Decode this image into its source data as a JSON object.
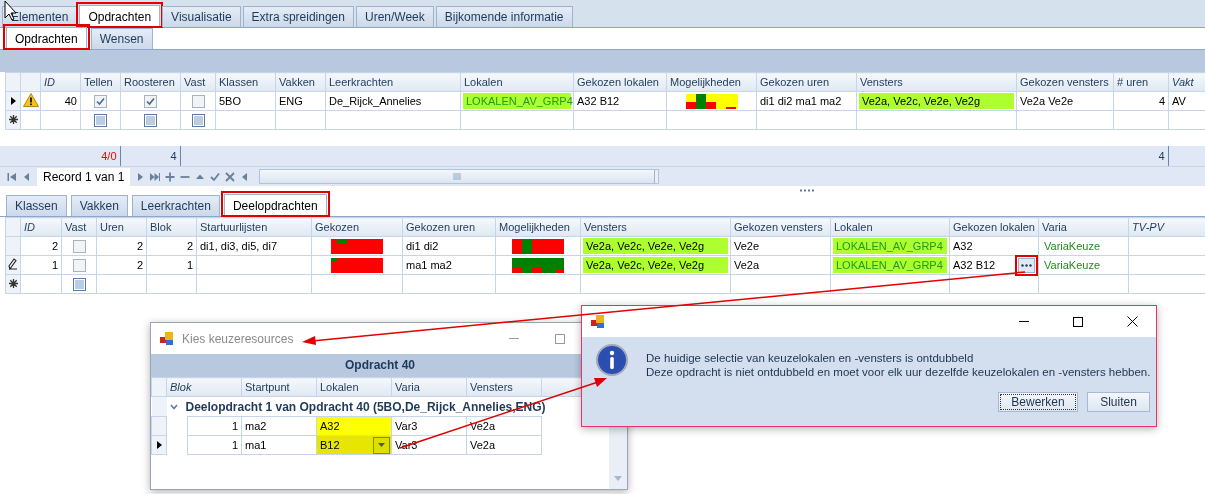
{
  "top_tabs": [
    {
      "label": "Elementen",
      "selected": false
    },
    {
      "label": "Opdrachten",
      "selected": true
    },
    {
      "label": "Visualisatie",
      "selected": false
    },
    {
      "label": "Extra spreidingen",
      "selected": false
    },
    {
      "label": "Uren/Week",
      "selected": false
    },
    {
      "label": "Bijkomende informatie",
      "selected": false
    }
  ],
  "sub_tabs": [
    {
      "label": "Opdrachten",
      "selected": true
    },
    {
      "label": "Wensen",
      "selected": false
    }
  ],
  "assignments_grid": {
    "columns": [
      {
        "label": "ID",
        "italic": true
      },
      {
        "label": "Tellen",
        "italic": false
      },
      {
        "label": "Roosteren",
        "italic": false
      },
      {
        "label": "Vast",
        "italic": false
      },
      {
        "label": "Klassen",
        "italic": false
      },
      {
        "label": "Vakken",
        "italic": false
      },
      {
        "label": "Leerkrachten",
        "italic": false
      },
      {
        "label": "Lokalen",
        "italic": false
      },
      {
        "label": "Gekozen lokalen",
        "italic": false
      },
      {
        "label": "Mogelijkheden",
        "italic": false
      },
      {
        "label": "Gekozen uren",
        "italic": false
      },
      {
        "label": "Vensters",
        "italic": false
      },
      {
        "label": "Gekozen vensters",
        "italic": false
      },
      {
        "label": "# uren",
        "italic": false
      },
      {
        "label": "Vakt",
        "italic": true
      }
    ],
    "rows": [
      {
        "kind": "current",
        "warning": true,
        "cells": [
          {
            "kind": "num",
            "text": "40"
          },
          {
            "kind": "check",
            "checked": true
          },
          {
            "kind": "check",
            "checked": true
          },
          {
            "kind": "check",
            "checked": false
          },
          {
            "kind": "text",
            "text": "5BO"
          },
          {
            "kind": "text",
            "text": "ENG"
          },
          {
            "kind": "text",
            "text": "De_Rijck_Annelies"
          },
          {
            "kind": "resource-group",
            "text": "LOKALEN_AV_GRP4"
          },
          {
            "kind": "text",
            "text": "A32 B12"
          },
          {
            "kind": "chart"
          },
          {
            "kind": "text",
            "text": "di1 di2 ma1 ma2"
          },
          {
            "kind": "window-list",
            "text": "Ve2a, Ve2c, Ve2e, Ve2g"
          },
          {
            "kind": "text",
            "text": "Ve2a Ve2e"
          },
          {
            "kind": "num",
            "text": "4"
          },
          {
            "kind": "text",
            "text": "AV"
          }
        ]
      },
      {
        "kind": "new",
        "warning": false,
        "cells": [
          {
            "kind": "empty"
          },
          {
            "kind": "check",
            "checked": false
          },
          {
            "kind": "check",
            "checked": false
          },
          {
            "kind": "check",
            "checked": false
          },
          {
            "kind": "empty"
          },
          {
            "kind": "empty"
          },
          {
            "kind": "empty"
          },
          {
            "kind": "empty"
          },
          {
            "kind": "empty"
          },
          {
            "kind": "empty"
          },
          {
            "kind": "empty"
          },
          {
            "kind": "empty"
          },
          {
            "kind": "empty"
          },
          {
            "kind": "empty"
          },
          {
            "kind": "empty"
          }
        ]
      }
    ],
    "summary": [
      {
        "kind": "empty"
      },
      {
        "kind": "alert",
        "text": "4/0"
      },
      {
        "kind": "sum",
        "text": "4"
      },
      {
        "kind": "empty"
      },
      {
        "kind": "empty"
      },
      {
        "kind": "empty"
      },
      {
        "kind": "empty"
      },
      {
        "kind": "empty"
      },
      {
        "kind": "empty"
      },
      {
        "kind": "empty"
      },
      {
        "kind": "empty"
      },
      {
        "kind": "empty"
      },
      {
        "kind": "empty"
      },
      {
        "kind": "sum",
        "text": "4"
      },
      {
        "kind": "empty"
      }
    ]
  },
  "navigator": {
    "record": "Record 1 van 1"
  },
  "detail_tabs": [
    {
      "label": "Klassen",
      "selected": false
    },
    {
      "label": "Vakken",
      "selected": false
    },
    {
      "label": "Leerkrachten",
      "selected": false
    },
    {
      "label": "Deelopdrachten",
      "selected": true
    }
  ],
  "parts_grid": {
    "columns": [
      {
        "label": "ID",
        "italic": true
      },
      {
        "label": "Vast",
        "italic": false
      },
      {
        "label": "Uren",
        "italic": false
      },
      {
        "label": "Blok",
        "italic": false
      },
      {
        "label": "Startuurlijsten",
        "italic": false
      },
      {
        "label": "Gekozen",
        "italic": false
      },
      {
        "label": "Gekozen uren",
        "italic": false
      },
      {
        "label": "Mogelijkheden",
        "italic": false
      },
      {
        "label": "Vensters",
        "italic": false
      },
      {
        "label": "Gekozen vensters",
        "italic": false
      },
      {
        "label": "Lokalen",
        "italic": false
      },
      {
        "label": "Gekozen lokalen",
        "italic": false
      },
      {
        "label": "Varia",
        "italic": false
      },
      {
        "label": "TV-PV",
        "italic": true
      }
    ],
    "rows": [
      {
        "kind": "plain",
        "cells": [
          {
            "kind": "num",
            "text": "2"
          },
          {
            "kind": "check",
            "checked": false
          },
          {
            "kind": "num",
            "text": "2"
          },
          {
            "kind": "num",
            "text": "2"
          },
          {
            "kind": "text",
            "text": "di1, di3, di5, di7"
          },
          {
            "kind": "chart"
          },
          {
            "kind": "text",
            "text": "di1 di2"
          },
          {
            "kind": "chart"
          },
          {
            "kind": "window-list",
            "text": "Ve2a, Ve2c, Ve2e, Ve2g"
          },
          {
            "kind": "text",
            "text": "Ve2e"
          },
          {
            "kind": "resource-group",
            "text": "LOKALEN_AV_GRP4"
          },
          {
            "kind": "text",
            "text": "A32"
          },
          {
            "kind": "option",
            "text": "VariaKeuze"
          },
          {
            "kind": "empty"
          }
        ]
      },
      {
        "kind": "editing",
        "cells": [
          {
            "kind": "num",
            "text": "1"
          },
          {
            "kind": "check",
            "checked": false
          },
          {
            "kind": "num",
            "text": "2"
          },
          {
            "kind": "num",
            "text": "1"
          },
          {
            "kind": "empty"
          },
          {
            "kind": "chart"
          },
          {
            "kind": "text",
            "text": "ma1 ma2"
          },
          {
            "kind": "chart"
          },
          {
            "kind": "window-list",
            "text": "Ve2a, Ve2c, Ve2e, Ve2g"
          },
          {
            "kind": "text",
            "text": "Ve2a"
          },
          {
            "kind": "resource-group",
            "text": "LOKALEN_AV_GRP4"
          },
          {
            "kind": "picker",
            "text": "A32 B12"
          },
          {
            "kind": "option",
            "text": "VariaKeuze"
          },
          {
            "kind": "empty"
          }
        ]
      },
      {
        "kind": "new",
        "cells": [
          {
            "kind": "empty"
          },
          {
            "kind": "check",
            "checked": false
          },
          {
            "kind": "empty"
          },
          {
            "kind": "empty"
          },
          {
            "kind": "empty"
          },
          {
            "kind": "empty"
          },
          {
            "kind": "empty"
          },
          {
            "kind": "empty"
          },
          {
            "kind": "empty"
          },
          {
            "kind": "empty"
          },
          {
            "kind": "empty"
          },
          {
            "kind": "empty"
          },
          {
            "kind": "empty"
          },
          {
            "kind": "empty"
          }
        ]
      }
    ]
  },
  "resource_dialog": {
    "title": "Kies keuzeresources",
    "band": "Opdracht 40",
    "columns": [
      {
        "label": "Blok",
        "italic": true
      },
      {
        "label": "Startpunt",
        "italic": false
      },
      {
        "label": "Lokalen",
        "italic": false
      },
      {
        "label": "Varia",
        "italic": false
      },
      {
        "label": "Vensters",
        "italic": false
      }
    ],
    "group": {
      "label": "Deelopdracht 1 van Opdracht 40 (5BO,De_Rijck_Annelies,ENG)",
      "expanded": true
    },
    "rows": [
      {
        "current": false,
        "cells": [
          {
            "kind": "num",
            "text": "1"
          },
          {
            "kind": "text",
            "text": "ma2"
          },
          {
            "kind": "highlight",
            "text": "A32"
          },
          {
            "kind": "text",
            "text": "Var3"
          },
          {
            "kind": "text",
            "text": "Ve2a"
          }
        ]
      },
      {
        "current": true,
        "cells": [
          {
            "kind": "num",
            "text": "1"
          },
          {
            "kind": "text",
            "text": "ma1"
          },
          {
            "kind": "highlight-dropdown",
            "text": "B12"
          },
          {
            "kind": "text",
            "text": "Var3"
          },
          {
            "kind": "text",
            "text": "Ve2a"
          }
        ]
      }
    ]
  },
  "message_dialog": {
    "lines": [
      "De huidige selectie van keuzelokalen en -vensters is ontdubbeld",
      "Deze opdracht is niet ontdubbeld en moet voor elk uur dezelfde keuzelokalen en -vensters hebben."
    ],
    "buttons": [
      {
        "label": "Bewerken",
        "focused": true
      },
      {
        "label": "Sluiten",
        "focused": false
      }
    ]
  }
}
